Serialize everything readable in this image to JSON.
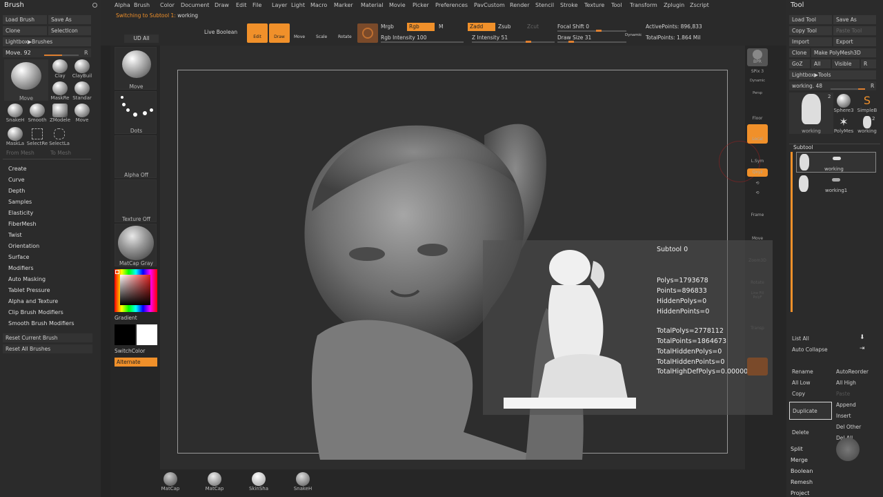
{
  "brush_panel": {
    "title": "Brush",
    "buttons": [
      [
        "Load Brush",
        "Save As"
      ],
      [
        "Clone",
        "SelectIcon"
      ],
      [
        "Lightbox▶Brushes",
        ""
      ]
    ],
    "slider": {
      "label": "Move. 92",
      "r": "R"
    },
    "current": "Move",
    "brushes": [
      "Clay",
      "ClayBuil",
      "MaskRe",
      "Standar",
      "SnakeH",
      "Smooth",
      "ZModele",
      "Move",
      "MaskLa",
      "SelectRe",
      "SelectLa"
    ],
    "from_mesh": "From Mesh",
    "to_mesh": "To Mesh",
    "menu": [
      "Create",
      "Curve",
      "Depth",
      "Samples",
      "Elasticity",
      "FiberMesh",
      "Twist",
      "Orientation",
      "Surface",
      "Modifiers",
      "Auto Masking",
      "Tablet Pressure",
      "Alpha and Texture",
      "Clip Brush Modifiers",
      "Smooth Brush Modifiers"
    ],
    "reset_current": "Reset Current Brush",
    "reset_all": "Reset All Brushes"
  },
  "menubar": [
    "Alpha",
    "Brush",
    "Color",
    "Document",
    "Draw",
    "Edit",
    "File",
    "Layer",
    "Light",
    "Macro",
    "Marker",
    "Material",
    "Movie",
    "Picker",
    "Preferences",
    "PavCustom",
    "Render",
    "Stencil",
    "Stroke",
    "Texture",
    "Tool",
    "Transform",
    "Zplugin",
    "Zscript"
  ],
  "status": {
    "prefix": "Switching to Subtool 1: ",
    "name": "working"
  },
  "toolbar": {
    "ud_all": "UD All",
    "live_boolean": "Live Boolean",
    "edit": "Edit",
    "draw": "Draw",
    "move": "Move",
    "scale": "Scale",
    "rotate": "Rotate",
    "mrgb": "Mrgb",
    "rgb": "Rgb",
    "m": "M",
    "rgb_intensity": "Rgb Intensity 100",
    "zadd": "Zadd",
    "zsub": "Zsub",
    "zcut": "Zcut",
    "z_intensity": "Z Intensity 51",
    "focal_shift": "Focal Shift 0",
    "draw_size": "Draw Size 31",
    "dynamic": "Dynamic",
    "active_points": "ActivePoints: 896,833",
    "total_points": "TotalPoints: 1.864 Mil"
  },
  "shelf": {
    "move": "Move",
    "dots": "Dots",
    "alpha_off": "Alpha Off",
    "texture_off": "Texture Off",
    "matcap": "MatCap Gray",
    "gradient": "Gradient",
    "switchcolor": "SwitchColor",
    "alternate": "Alternate"
  },
  "right_tray": {
    "bpr": "BPR",
    "spix": "SPix 3",
    "dynamic": "Dynamic",
    "persp": "Persp",
    "floor": "Floor",
    "local": "Local",
    "lsym": "L.Sym",
    "qxyz": "Qxyz",
    "frame": "Frame",
    "move": "Move",
    "zoom3d": "Zoom3D",
    "rotate": "Rotate",
    "linefill": "Line Fill PolyF",
    "transp": "Transp"
  },
  "info": {
    "title": "Subtool 0",
    "polys": "Polys=1793678",
    "points": "Points=896833",
    "hidden_polys": "HiddenPolys=0",
    "hidden_points": "HiddenPoints=0",
    "total_polys": "TotalPolys=2778112",
    "total_points": "TotalPoints=1864673",
    "total_hidden_polys": "TotalHiddenPolys=0",
    "total_hidden_points": "TotalHiddenPoints=0",
    "total_highdef": "TotalHighDefPolys=0.0000000 Mil"
  },
  "tool_panel": {
    "title": "Tool",
    "rows": [
      [
        "Load Tool",
        "Save As"
      ],
      [
        "Copy Tool",
        "Paste Tool"
      ],
      [
        "Import",
        "Export"
      ],
      [
        "Clone",
        "Make PolyMesh3D"
      ],
      [
        "GoZ",
        "All",
        "Visible",
        "R"
      ]
    ],
    "lightbox": "Lightbox▶Tools",
    "slider": "working. 48",
    "r": "R",
    "tools": [
      "working",
      "Sphere3",
      "SimpleB",
      "PolyMes",
      "working"
    ],
    "badges": [
      "2",
      "2"
    ],
    "subtool_header": "Subtool",
    "subtools": [
      "working",
      "working1"
    ],
    "list_all": "List All",
    "auto_collapse": "Auto Collapse",
    "actions": [
      [
        "Rename",
        "AutoReorder"
      ],
      [
        "All Low",
        "All High"
      ],
      [
        "Copy",
        "Paste"
      ],
      [
        "Duplicate",
        "Append"
      ],
      [
        "",
        "Insert"
      ],
      [
        "Delete",
        "Del Other"
      ],
      [
        "",
        "Del All"
      ]
    ],
    "menu": [
      "Split",
      "Merge",
      "Boolean",
      "Remesh",
      "Project"
    ]
  },
  "bottom": [
    "MatCap",
    "MatCap",
    "SkinSha",
    "SnakeH"
  ]
}
